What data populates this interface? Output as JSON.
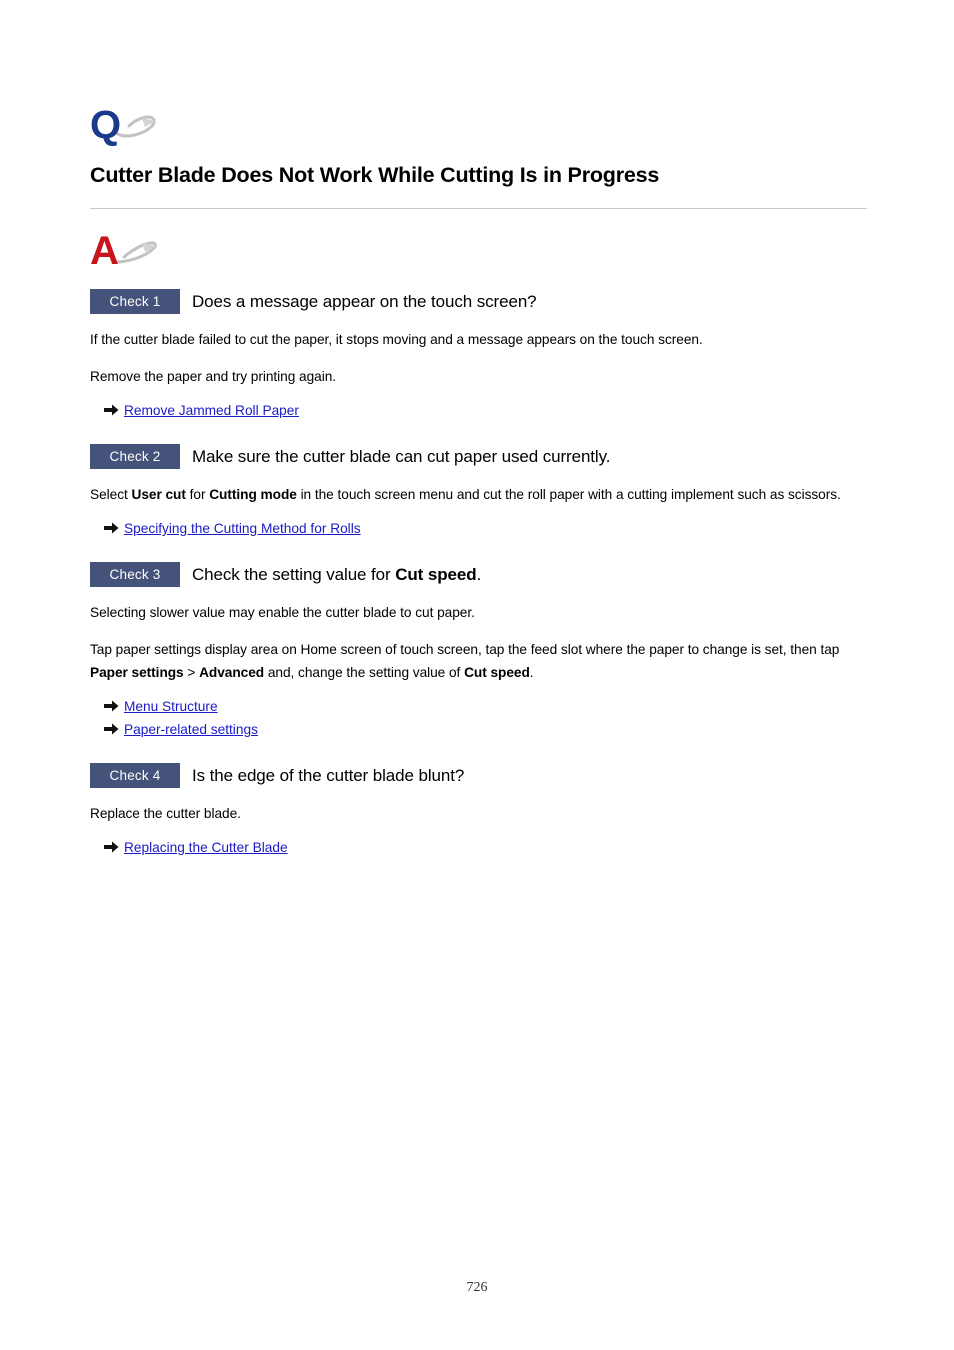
{
  "document": {
    "question_mark_letter": "Q",
    "answer_mark_letter": "A",
    "title": "Cutter Blade Does Not Work While Cutting Is in Progress",
    "page_number": "726",
    "colors": {
      "badge_background": "#45527a",
      "badge_text": "#ffffff",
      "link": "#1a1ac8",
      "q_mark": "#1b3a8c",
      "a_mark": "#c8141c",
      "divider": "#c9c9c9"
    }
  },
  "checks": [
    {
      "badge": "Check 1",
      "title_plain": "Does a message appear on the touch screen?",
      "paragraphs": [
        "If the cutter blade failed to cut the paper, it stops moving and a message appears on the touch screen.",
        "Remove the paper and try printing again."
      ],
      "links": [
        "Remove Jammed Roll Paper"
      ]
    },
    {
      "badge": "Check 2",
      "title_plain": "Make sure the cutter blade can cut paper used currently.",
      "paragraph_rich": {
        "part1": "Select ",
        "bold1": "User cut",
        "part2": " for ",
        "bold2": "Cutting mode",
        "part3": " in the touch screen menu and cut the roll paper with a cutting implement such as scissors."
      },
      "links": [
        "Specifying the Cutting Method for Rolls"
      ]
    },
    {
      "badge": "Check 3",
      "title_rich": {
        "part1": "Check the setting value for ",
        "bold1": "Cut speed",
        "part2": "."
      },
      "paragraphs": [
        "Selecting slower value may enable the cutter blade to cut paper."
      ],
      "paragraph_rich": {
        "part1": "Tap paper settings display area on Home screen of touch screen, tap the feed slot where the paper to change is set, then tap ",
        "bold1": "Paper settings",
        "part2": " > ",
        "bold2": "Advanced",
        "part3": " and, change the setting value of ",
        "bold3": "Cut speed",
        "part4": "."
      },
      "links": [
        "Menu Structure",
        "Paper-related settings"
      ]
    },
    {
      "badge": "Check 4",
      "title_plain": "Is the edge of the cutter blade blunt?",
      "paragraphs": [
        "Replace the cutter blade."
      ],
      "links": [
        "Replacing the Cutter Blade"
      ]
    }
  ]
}
